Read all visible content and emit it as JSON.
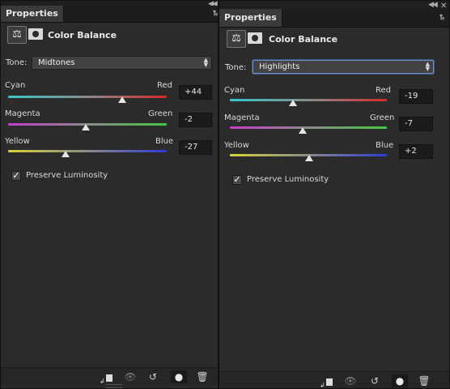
{
  "left": {
    "tab_label": "Properties",
    "title": "Color Balance",
    "tone_label": "Tone:",
    "tone_value": "Midtones",
    "sliders": [
      {
        "left": "Cyan",
        "right": "Red",
        "value": "+44"
      },
      {
        "left": "Magenta",
        "right": "Green",
        "value": "-2"
      },
      {
        "left": "Yellow",
        "right": "Blue",
        "value": "-27"
      }
    ],
    "preserve_label": "Preserve Luminosity",
    "preserve_checked": true
  },
  "right": {
    "tab_label": "Properties",
    "title": "Color Balance",
    "tone_label": "Tone:",
    "tone_value": "Highlights",
    "sliders": [
      {
        "left": "Cyan",
        "right": "Red",
        "value": "-19"
      },
      {
        "left": "Magenta",
        "right": "Green",
        "value": "-7"
      },
      {
        "left": "Yellow",
        "right": "Blue",
        "value": "+2"
      }
    ],
    "preserve_label": "Preserve Luminosity",
    "preserve_checked": true
  },
  "icons": {
    "collapse": "double-chevron-left-icon",
    "close": "close-icon",
    "panel_menu": "panel-menu-icon",
    "adjustment": "balance-scale-icon",
    "mask": "layer-mask-icon",
    "clip": "clip-to-layer-icon",
    "view_previous": "view-previous-state-icon",
    "reset": "reset-icon",
    "visibility": "eye-icon",
    "delete": "trash-icon"
  }
}
